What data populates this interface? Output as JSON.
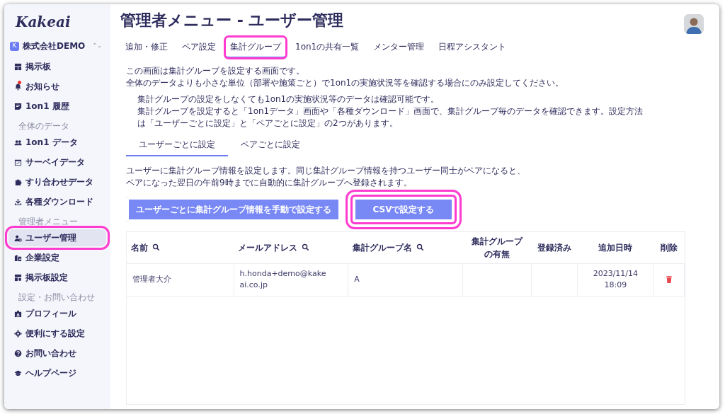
{
  "sidebar": {
    "logo": "Kakeai",
    "org": {
      "badge": "K",
      "name": "株式会社DEMO",
      "switcher": "⌃⌄"
    },
    "groups": [
      {
        "items": [
          {
            "label": "掲示板",
            "selected": false,
            "highlighted": false,
            "unread": false
          },
          {
            "label": "お知らせ",
            "selected": false,
            "highlighted": false,
            "unread": true
          },
          {
            "label": "1on1 履歴",
            "selected": false,
            "highlighted": false,
            "unread": false
          }
        ]
      },
      {
        "heading": "全体のデータ",
        "items": [
          {
            "label": "1on1 データ",
            "selected": false,
            "highlighted": false,
            "unread": false
          },
          {
            "label": "サーベイデータ",
            "selected": false,
            "highlighted": false,
            "unread": false
          },
          {
            "label": "すり合わせデータ",
            "selected": false,
            "highlighted": false,
            "unread": false
          },
          {
            "label": "各種ダウンロード",
            "selected": false,
            "highlighted": false,
            "unread": false
          }
        ]
      },
      {
        "heading": "管理者メニュー",
        "items": [
          {
            "label": "ユーザー管理",
            "selected": true,
            "highlighted": true,
            "unread": false
          },
          {
            "label": "企業設定",
            "selected": false,
            "highlighted": false,
            "unread": false
          },
          {
            "label": "掲示板設定",
            "selected": false,
            "highlighted": false,
            "unread": false
          }
        ]
      },
      {
        "heading": "設定・お問い合わせ",
        "items": [
          {
            "label": "プロフィール",
            "selected": false,
            "highlighted": false,
            "unread": false
          },
          {
            "label": "便利にする設定",
            "selected": false,
            "highlighted": false,
            "unread": false
          },
          {
            "label": "お問い合わせ",
            "selected": false,
            "highlighted": false,
            "unread": false
          },
          {
            "label": "ヘルプページ",
            "selected": false,
            "highlighted": false,
            "unread": false
          }
        ]
      }
    ]
  },
  "page": {
    "title": "管理者メニュー - ユーザー管理"
  },
  "tabs": [
    {
      "label": "追加・修正",
      "selected": false,
      "highlighted": false
    },
    {
      "label": "ペア設定",
      "selected": false,
      "highlighted": false
    },
    {
      "label": "集計グループ",
      "selected": true,
      "highlighted": true
    },
    {
      "label": "1on1の共有一覧",
      "selected": false,
      "highlighted": false
    },
    {
      "label": "メンター管理",
      "selected": false,
      "highlighted": false
    },
    {
      "label": "日程アシスタント",
      "selected": false,
      "highlighted": false
    }
  ],
  "intro": [
    "この画面は集計グループを設定する画面です。",
    "全体のデータよりも小さな単位（部署や施策ごと）で1on1の実施状況等を確認する場合にのみ設定してください。"
  ],
  "notes": [
    "集計グループの設定をしなくても1on1の実施状況等のデータは確認可能です。",
    "集計グループを設定すると「1on1データ」画面や「各種ダウンロード」画面で、集計グループ毎のデータを確認できます。設定方法は「ユーザーごとに設定」と「ペアごとに設定」の2つがあります。"
  ],
  "subtabs": [
    {
      "label": "ユーザーごとに設定",
      "selected": true
    },
    {
      "label": "ペアごとに設定",
      "selected": false
    }
  ],
  "description": [
    "ユーザーに集計グループ情報を設定します。同じ集計グループ情報を持つユーザー同士がペアになると、",
    "ペアになった翌日の午前9時までに自動的に集計グループへ登録されます。"
  ],
  "buttons": [
    {
      "label": "ユーザーごとに集計グループ情報を手動で設定する",
      "highlighted": false
    },
    {
      "label": "CSVで設定する",
      "highlighted": true
    }
  ],
  "table": {
    "columns": [
      {
        "label": "名前",
        "searchable": true
      },
      {
        "label": "メールアドレス",
        "searchable": true
      },
      {
        "label": "集計グループ名",
        "searchable": true
      },
      {
        "label": "集計グループの有無",
        "searchable": false
      },
      {
        "label": "登録済み",
        "searchable": false
      },
      {
        "label": "追加日時",
        "searchable": false
      },
      {
        "label": "削除",
        "searchable": false
      }
    ],
    "rows": [
      {
        "name": "管理者大介",
        "email": "h.honda+demo@kakeai.co.jp",
        "group": "A",
        "added": "2023/11/14 18:09"
      }
    ]
  }
}
